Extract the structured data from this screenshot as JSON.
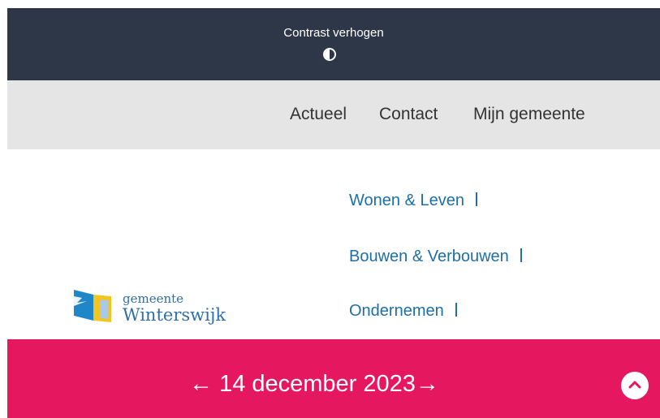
{
  "contrast": {
    "label": "Contrast verhogen",
    "icon": "contrast-icon"
  },
  "service_nav": {
    "items": [
      "Actueel",
      "Contact",
      "Mijn gemeente"
    ]
  },
  "logo": {
    "line1": "gemeente",
    "line2": "Winterswijk"
  },
  "main_nav": {
    "items": [
      "Wonen & Leven",
      "Bouwen & Verbouwen",
      "Ondernemen"
    ]
  },
  "date_banner": {
    "prev": "←",
    "date": "14 december 2023",
    "next": "→",
    "scroll_icon": "chevron-up-icon"
  },
  "colors": {
    "top_bar": "#2e3748",
    "service_bar": "#e5e5e5",
    "link": "#1d6fa5",
    "banner": "#e5185f"
  }
}
